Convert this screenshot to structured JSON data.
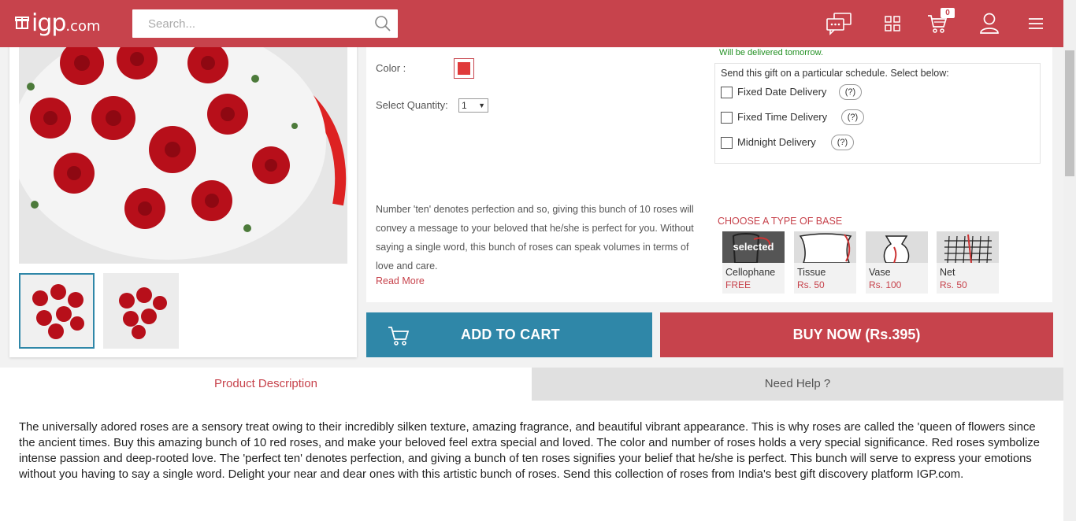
{
  "header": {
    "logo_big": "igp",
    "logo_small": ".com",
    "search_placeholder": "Search...",
    "cart_count": "0",
    "icons": [
      "chat-icon",
      "grid-icon",
      "cart-icon",
      "user-icon",
      "menu-icon"
    ],
    "brand_color": "#c7434c"
  },
  "product": {
    "color_label": "Color :",
    "color_value": "#e03a3a",
    "quantity_label": "Select Quantity:",
    "quantity_value": "1",
    "description": "Number 'ten' denotes perfection and so, giving this bunch of 10 roses will convey a message to your beloved that he/she is perfect for you. Without saying a single word, this bunch of roses can speak volumes in terms of love and care.",
    "read_more": "Read More"
  },
  "delivery": {
    "delivered_note": "Will be delivered tomorrow.",
    "schedule_title": "Send this gift on a particular schedule. Select below:",
    "options": [
      {
        "label": "Fixed Date Delivery",
        "help": "(?)"
      },
      {
        "label": "Fixed Time Delivery",
        "help": "(?)"
      },
      {
        "label": "Midnight Delivery",
        "help": "(?)"
      }
    ]
  },
  "base": {
    "title": "CHOOSE A TYPE OF BASE",
    "selected_label": "selected",
    "options": [
      {
        "name": "Cellophane",
        "price": "FREE"
      },
      {
        "name": "Tissue",
        "price": "Rs. 50"
      },
      {
        "name": "Vase",
        "price": "Rs. 100"
      },
      {
        "name": "Net",
        "price": "Rs. 50"
      }
    ]
  },
  "actions": {
    "add_to_cart": "ADD TO CART",
    "buy_now": "BUY NOW (Rs.395)"
  },
  "tabs": {
    "product_description": "Product Description",
    "need_help": "Need Help ?"
  },
  "long_description": "The universally adored roses are a sensory treat owing to their incredibly silken texture, amazing fragrance, and beautiful vibrant appearance. This is why roses are called the 'queen of flowers since the ancient times. Buy this amazing bunch of 10 red roses, and make your beloved feel extra special and loved. The color and number of roses holds a very special significance. Red roses symbolize intense passion and deep-rooted love. The 'perfect ten' denotes perfection, and giving a bunch of ten roses signifies your belief that he/she is perfect. This bunch will serve to express your emotions without you having to say a single word. Delight your near and dear ones with this artistic bunch of roses. Send this collection of roses from India's best gift discovery platform IGP.com."
}
